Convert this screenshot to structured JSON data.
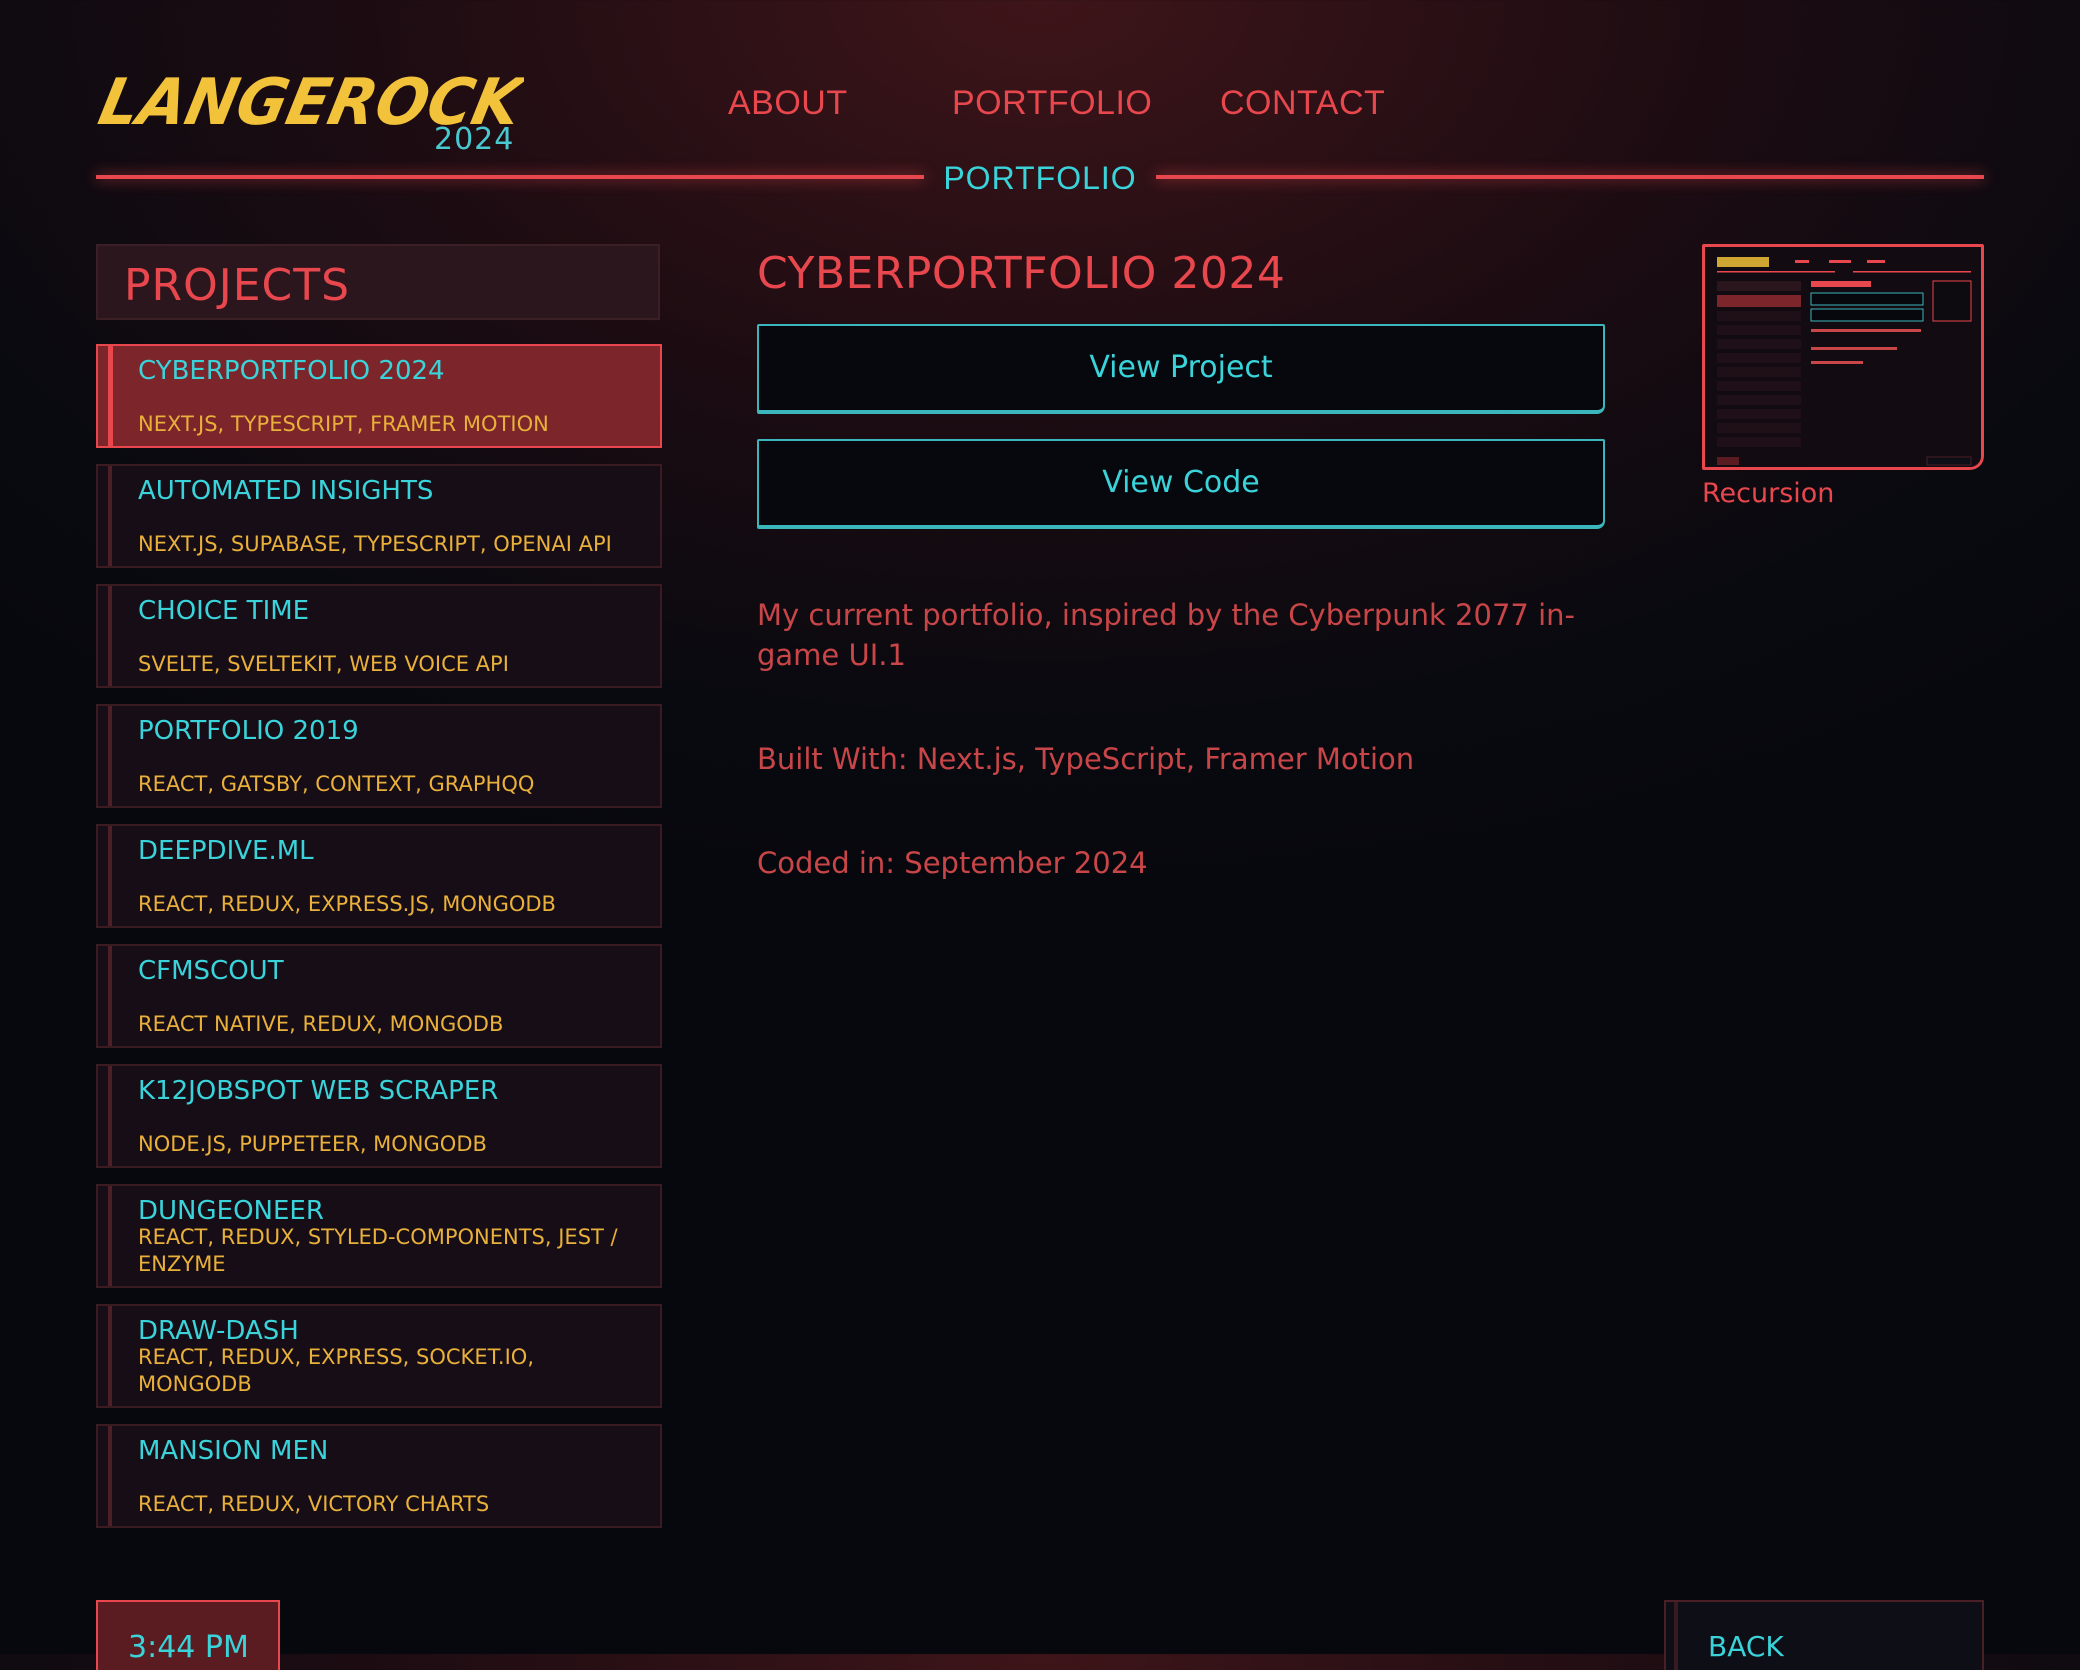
{
  "brand": {
    "logo_text": "LANGEROCK",
    "year": "2024",
    "logo_color": "#f2c23a"
  },
  "nav": {
    "about": "ABOUT",
    "portfolio": "PORTFOLIO",
    "contact": "CONTACT",
    "current_section": "PORTFOLIO"
  },
  "sidebar": {
    "heading": "PROJECTS",
    "projects": [
      {
        "title": "CYBERPORTFOLIO 2024",
        "tech": "NEXT.JS, TYPESCRIPT, FRAMER MOTION",
        "active": true
      },
      {
        "title": "AUTOMATED INSIGHTS",
        "tech": "NEXT.JS, SUPABASE, TYPESCRIPT, OPENAI API"
      },
      {
        "title": "CHOICE TIME",
        "tech": "SVELTE, SVELTEKIT, WEB VOICE API"
      },
      {
        "title": "PORTFOLIO 2019",
        "tech": "REACT, GATSBY, CONTEXT, GRAPHQQ"
      },
      {
        "title": "DEEPDIVE.ML",
        "tech": "REACT, REDUX, EXPRESS.JS, MONGODB"
      },
      {
        "title": "CFMSCOUT",
        "tech": "REACT NATIVE, REDUX, MONGODB"
      },
      {
        "title": "K12JOBSPOT WEB SCRAPER",
        "tech": "NODE.JS, PUPPETEER, MONGODB"
      },
      {
        "title": "DUNGEONEER",
        "tech": "REACT, REDUX, STYLED-COMPONENTS, JEST / ENZYME"
      },
      {
        "title": "DRAW-DASH",
        "tech": "REACT, REDUX, EXPRESS, SOCKET.IO, MONGODB"
      },
      {
        "title": "MANSION MEN",
        "tech": "REACT, REDUX, VICTORY CHARTS"
      }
    ]
  },
  "detail": {
    "title": "CYBERPORTFOLIO 2024",
    "view_project": "View Project",
    "view_code": "View Code",
    "description": "My current portfolio, inspired by the Cyberpunk 2077 in-game UI.1",
    "built_with": "Built With: Next.js, TypeScript, Framer Motion",
    "coded_in": "Coded in: September 2024"
  },
  "preview": {
    "caption": "Recursion"
  },
  "footer": {
    "time": "3:44 PM",
    "back": "BACK"
  },
  "colors": {
    "accent_red": "#e8474d",
    "accent_cyan": "#3ad3da",
    "accent_yellow": "#e9b03a"
  }
}
